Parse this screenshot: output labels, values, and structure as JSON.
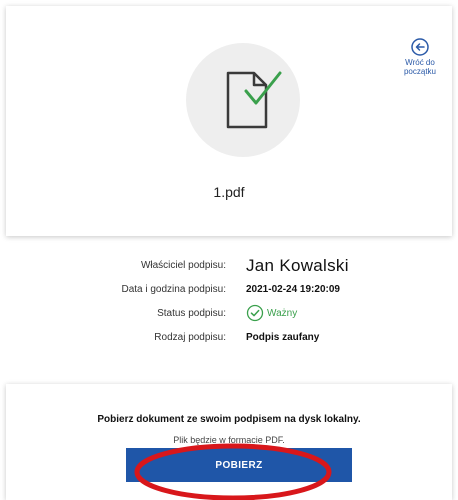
{
  "document": {
    "filename": "1.pdf",
    "icon": "document-check-icon"
  },
  "back_link": {
    "label_line1": "Wróć do",
    "label_line2": "początku",
    "icon": "arrow-left-circle-icon"
  },
  "signature": {
    "owner_label": "Właściciel podpisu:",
    "owner_value": "Jan Kowalski",
    "datetime_label": "Data i godzina podpisu:",
    "datetime_value": "2021-02-24 19:20:09",
    "status_label": "Status podpisu:",
    "status_value": "Ważny",
    "status_icon": "check-circle-icon",
    "type_label": "Rodzaj podpisu:",
    "type_value": "Podpis zaufany"
  },
  "download": {
    "title": "Pobierz dokument ze swoim podpisem na dysk lokalny.",
    "subtitle": "Plik będzie w formacie PDF.",
    "button_label": "POBIERZ"
  },
  "colors": {
    "accent": "#1f56a8",
    "status_ok": "#3aa04c",
    "annotation": "#d8171b"
  }
}
